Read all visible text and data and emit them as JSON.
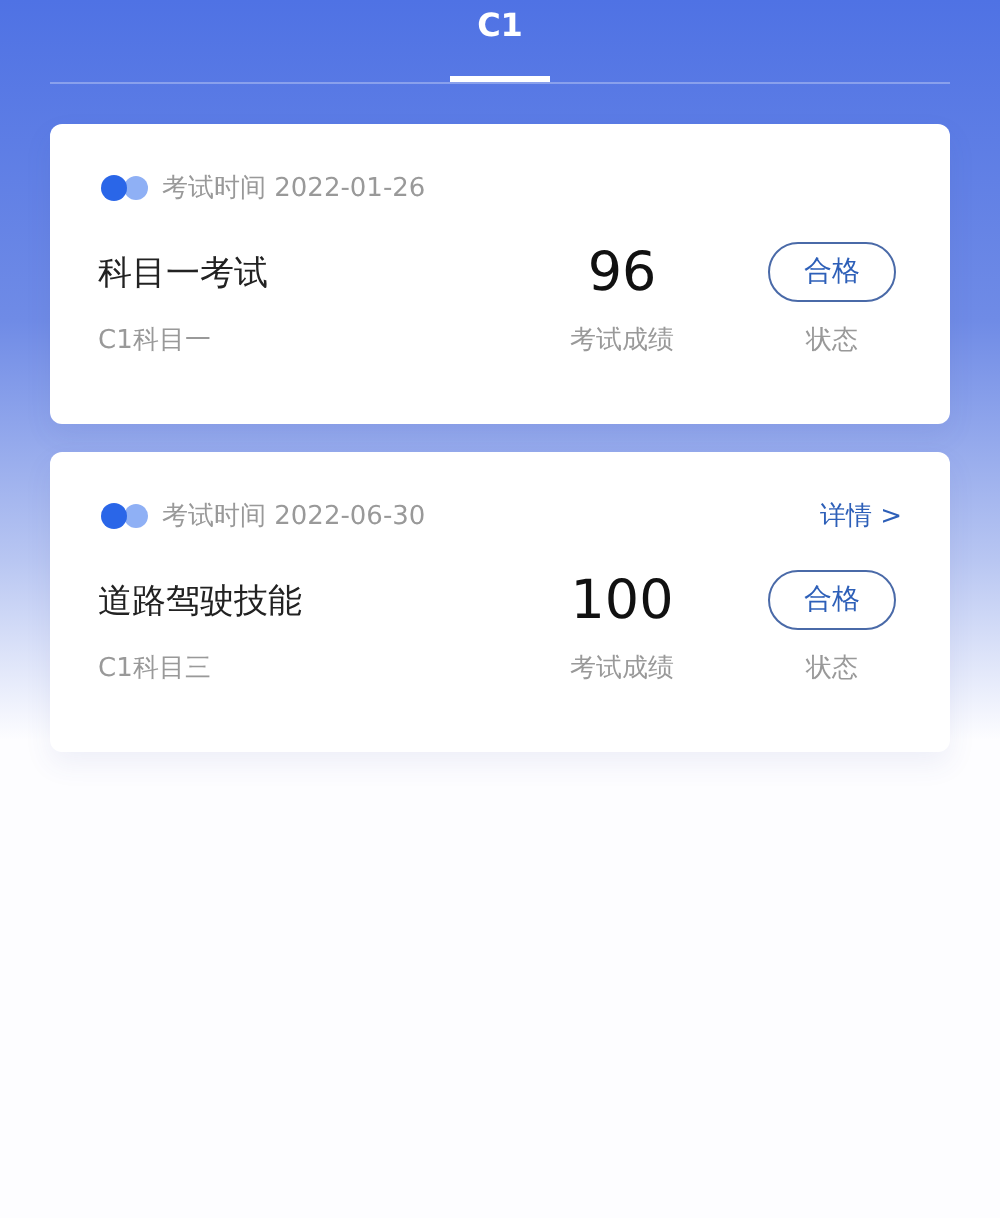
{
  "tabs": [
    {
      "label": "C1",
      "selected": true
    }
  ],
  "exams": [
    {
      "date": "考试时间 2022-01-26",
      "title": "科目一考试",
      "score": "96",
      "status": "合格",
      "subject": "C1科目一",
      "score_label": "考试成绩",
      "status_label": "状态"
    },
    {
      "date": "考试时间 2022-06-30",
      "detail_link": "详情 >",
      "title": "道路驾驶技能",
      "score": "100",
      "status": "合格",
      "subject": "C1科目三",
      "score_label": "考试成绩",
      "status_label": "状态"
    }
  ]
}
